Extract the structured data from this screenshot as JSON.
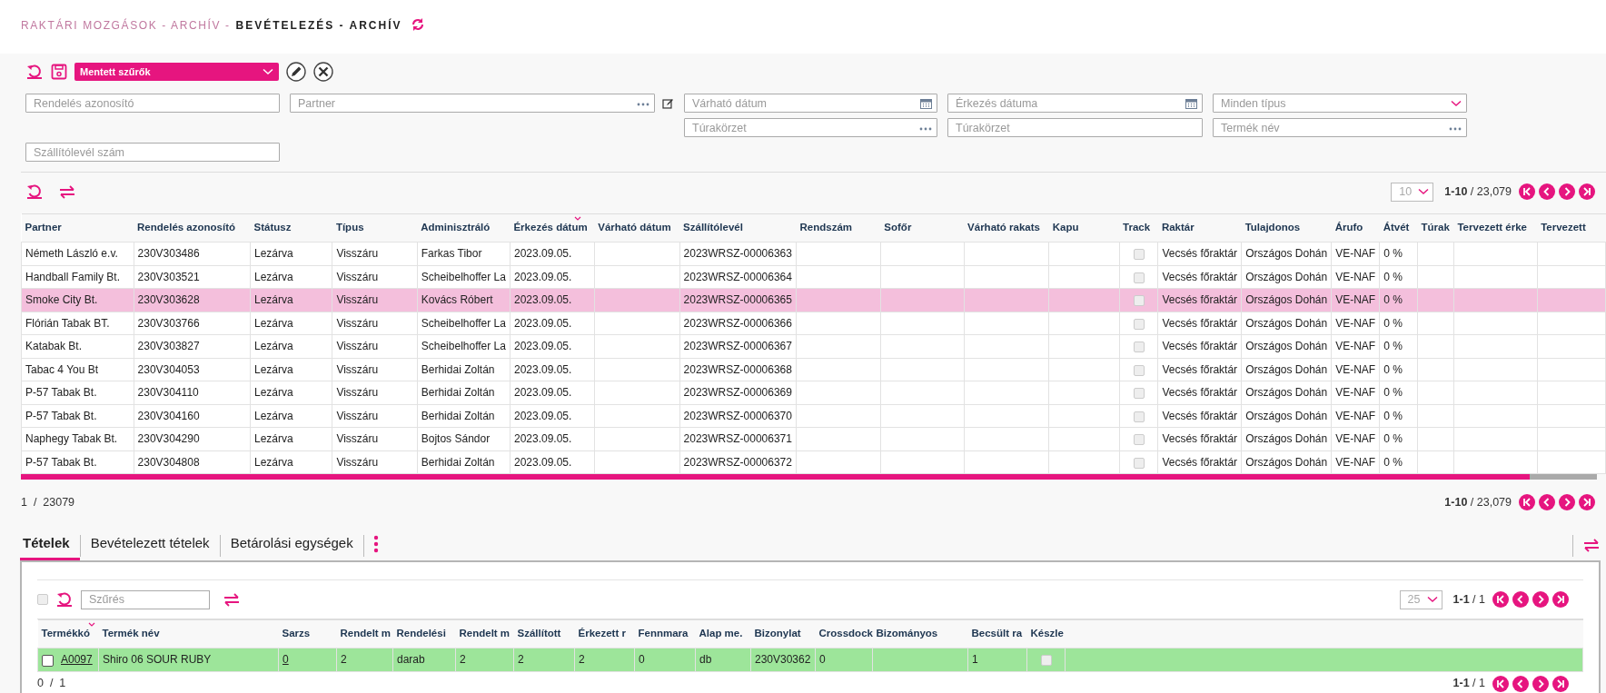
{
  "breadcrumb": [
    {
      "label": "RAKTÁRI MOZGÁSOK - ARCHÍV -",
      "current": false
    },
    {
      "label": "BEVÉTELEZÉS - ARCHÍV",
      "current": true
    }
  ],
  "saved_filters": {
    "label": "Mentett szűrők"
  },
  "filter_rows": [
    [
      {
        "kind": "text",
        "placeholder": "Rendelés azonosító"
      },
      {
        "kind": "lookup_edit",
        "placeholder": "Partner"
      },
      {
        "kind": "date",
        "placeholder": "Várható dátum"
      },
      {
        "kind": "date",
        "placeholder": "Érkezés dátuma"
      },
      {
        "kind": "select",
        "placeholder": "Minden típus"
      }
    ],
    [
      {
        "kind": "blank"
      },
      {
        "kind": "blank"
      },
      {
        "kind": "lookup",
        "placeholder": "Túrakörzet"
      },
      {
        "kind": "text",
        "placeholder": "Túrakörzet"
      },
      {
        "kind": "lookup",
        "placeholder": "Termék név"
      }
    ],
    [
      {
        "kind": "text",
        "placeholder": "Szállítólevél szám"
      }
    ]
  ],
  "table": {
    "pager": {
      "page_size": "10",
      "range": "1-10",
      "total": "/ 23,079"
    },
    "columns": [
      {
        "label": "Partner",
        "kind": "text",
        "sorted": false
      },
      {
        "label": "Rendelés azonosító",
        "kind": "text",
        "sorted": false
      },
      {
        "label": "Státusz",
        "kind": "text",
        "sorted": false
      },
      {
        "label": "Típus",
        "kind": "text",
        "sorted": false
      },
      {
        "label": "Adminisztráló",
        "kind": "text",
        "sorted": false
      },
      {
        "label": "Érkezés dátum",
        "kind": "text",
        "sorted": true
      },
      {
        "label": "Várható dátum",
        "kind": "text",
        "sorted": false
      },
      {
        "label": "Szállítólevél",
        "kind": "text",
        "sorted": false
      },
      {
        "label": "Rendszám",
        "kind": "text",
        "sorted": false
      },
      {
        "label": "Sofőr",
        "kind": "text",
        "sorted": false
      },
      {
        "label": "Várható rakats",
        "kind": "text",
        "sorted": false
      },
      {
        "label": "Kapu",
        "kind": "text",
        "sorted": false
      },
      {
        "label": "Track",
        "kind": "check",
        "sorted": false
      },
      {
        "label": "Raktár",
        "kind": "text",
        "sorted": false
      },
      {
        "label": "Tulajdonos",
        "kind": "text",
        "sorted": false
      },
      {
        "label": "Árufo",
        "kind": "text",
        "sorted": false
      },
      {
        "label": "Átvét",
        "kind": "text",
        "sorted": false
      },
      {
        "label": "Túrak",
        "kind": "text",
        "sorted": false
      },
      {
        "label": "Tervezett érke",
        "kind": "text",
        "sorted": false
      },
      {
        "label": "Tervezett",
        "kind": "text",
        "sorted": false
      }
    ],
    "rows": [
      {
        "selected": false,
        "tracking": false,
        "cells": [
          "Németh László e.v.",
          "230V303486",
          "Lezárva",
          "Visszáru",
          "Farkas Tibor",
          "2023.09.05.",
          null,
          "2023WRSZ-00006363",
          null,
          null,
          null,
          null,
          null,
          "Vecsés főraktár",
          "Országos Dohán",
          "VE-NAF",
          "0 %",
          null,
          null,
          null
        ]
      },
      {
        "selected": false,
        "tracking": false,
        "cells": [
          "Handball Family Bt.",
          "230V303521",
          "Lezárva",
          "Visszáru",
          "Scheibelhoffer La",
          "2023.09.05.",
          null,
          "2023WRSZ-00006364",
          null,
          null,
          null,
          null,
          null,
          "Vecsés főraktár",
          "Országos Dohán",
          "VE-NAF",
          "0 %",
          null,
          null,
          null
        ]
      },
      {
        "selected": true,
        "tracking": false,
        "cells": [
          "Smoke City Bt.",
          "230V303628",
          "Lezárva",
          "Visszáru",
          "Kovács Róbert",
          "2023.09.05.",
          null,
          "2023WRSZ-00006365",
          null,
          null,
          null,
          null,
          null,
          "Vecsés főraktár",
          "Országos Dohán",
          "VE-NAF",
          "0 %",
          null,
          null,
          null
        ]
      },
      {
        "selected": false,
        "tracking": false,
        "cells": [
          "Flórián Tabak BT.",
          "230V303766",
          "Lezárva",
          "Visszáru",
          "Scheibelhoffer La",
          "2023.09.05.",
          null,
          "2023WRSZ-00006366",
          null,
          null,
          null,
          null,
          null,
          "Vecsés főraktár",
          "Országos Dohán",
          "VE-NAF",
          "0 %",
          null,
          null,
          null
        ]
      },
      {
        "selected": false,
        "tracking": false,
        "cells": [
          "Katabak Bt.",
          "230V303827",
          "Lezárva",
          "Visszáru",
          "Scheibelhoffer La",
          "2023.09.05.",
          null,
          "2023WRSZ-00006367",
          null,
          null,
          null,
          null,
          null,
          "Vecsés főraktár",
          "Országos Dohán",
          "VE-NAF",
          "0 %",
          null,
          null,
          null
        ]
      },
      {
        "selected": false,
        "tracking": false,
        "cells": [
          "Tabac 4 You Bt",
          "230V304053",
          "Lezárva",
          "Visszáru",
          "Berhidai Zoltán",
          "2023.09.05.",
          null,
          "2023WRSZ-00006368",
          null,
          null,
          null,
          null,
          null,
          "Vecsés főraktár",
          "Országos Dohán",
          "VE-NAF",
          "0 %",
          null,
          null,
          null
        ]
      },
      {
        "selected": false,
        "tracking": false,
        "cells": [
          "P-57 Tabak Bt.",
          "230V304110",
          "Lezárva",
          "Visszáru",
          "Berhidai Zoltán",
          "2023.09.05.",
          null,
          "2023WRSZ-00006369",
          null,
          null,
          null,
          null,
          null,
          "Vecsés főraktár",
          "Országos Dohán",
          "VE-NAF",
          "0 %",
          null,
          null,
          null
        ]
      },
      {
        "selected": false,
        "tracking": false,
        "cells": [
          "P-57 Tabak Bt.",
          "230V304160",
          "Lezárva",
          "Visszáru",
          "Berhidai Zoltán",
          "2023.09.05.",
          null,
          "2023WRSZ-00006370",
          null,
          null,
          null,
          null,
          null,
          "Vecsés főraktár",
          "Országos Dohán",
          "VE-NAF",
          "0 %",
          null,
          null,
          null
        ]
      },
      {
        "selected": false,
        "tracking": false,
        "cells": [
          "Naphegy Tabak Bt.",
          "230V304290",
          "Lezárva",
          "Visszáru",
          "Bojtos Sándor",
          "2023.09.05.",
          null,
          "2023WRSZ-00006371",
          null,
          null,
          null,
          null,
          null,
          "Vecsés főraktár",
          "Országos Dohán",
          "VE-NAF",
          "0 %",
          null,
          null,
          null
        ]
      },
      {
        "selected": false,
        "tracking": false,
        "cells": [
          "P-57 Tabak Bt.",
          "230V304808",
          "Lezárva",
          "Visszáru",
          "Berhidai Zoltán",
          "2023.09.05.",
          null,
          "2023WRSZ-00006372",
          null,
          null,
          null,
          null,
          null,
          "Vecsés főraktár",
          "Országos Dohán",
          "VE-NAF",
          "0 %",
          null,
          null,
          null
        ]
      }
    ],
    "footer_count": "1  /  23079",
    "footer_pager": {
      "range": "1-10",
      "total": "/ 23,079"
    }
  },
  "tabs": [
    {
      "label": "Tételek",
      "selected": true
    },
    {
      "label": "Bevételezett tételek",
      "selected": false
    },
    {
      "label": "Betárolási egységek",
      "selected": false
    }
  ],
  "items": {
    "select_all": false,
    "filter_placeholder": "Szűrés",
    "pager": {
      "page_size": "25",
      "range": "1-1",
      "total": "/ 1"
    },
    "columns": [
      {
        "label": "Termékkó",
        "kind": "select_link",
        "sorted": true
      },
      {
        "label": "Termék név",
        "kind": "text",
        "sorted": false
      },
      {
        "label": "Sarzs",
        "kind": "link",
        "sorted": false
      },
      {
        "label": "Rendelt m",
        "kind": "text",
        "sorted": false
      },
      {
        "label": "Rendelési",
        "kind": "text",
        "sorted": false
      },
      {
        "label": "Rendelt m",
        "kind": "text",
        "sorted": false
      },
      {
        "label": "Szállított",
        "kind": "text",
        "sorted": false
      },
      {
        "label": "Érkezett r",
        "kind": "text",
        "sorted": false
      },
      {
        "label": "Fennmara",
        "kind": "text",
        "sorted": false
      },
      {
        "label": "Alap me.",
        "kind": "text",
        "sorted": false
      },
      {
        "label": "Bizonylat",
        "kind": "text",
        "sorted": false
      },
      {
        "label": "Crossdock",
        "kind": "text",
        "sorted": false
      },
      {
        "label": "Bizományos",
        "kind": "text",
        "sorted": false
      },
      {
        "label": "Becsült ra",
        "kind": "text",
        "sorted": false
      },
      {
        "label": "Készle",
        "kind": "check",
        "sorted": false
      }
    ],
    "rows": [
      {
        "checked": false,
        "highlighted": true,
        "stock": false,
        "cells": [
          "A0097",
          "Shiro 06 SOUR RUBY",
          "0",
          "2",
          "darab",
          "2",
          "2",
          "2",
          "0",
          "db",
          "230V30362",
          "0",
          null,
          "1",
          null
        ]
      }
    ],
    "footer_count": "0  /  1",
    "footer_pager": {
      "range": "1-1",
      "total": "/ 1"
    }
  }
}
